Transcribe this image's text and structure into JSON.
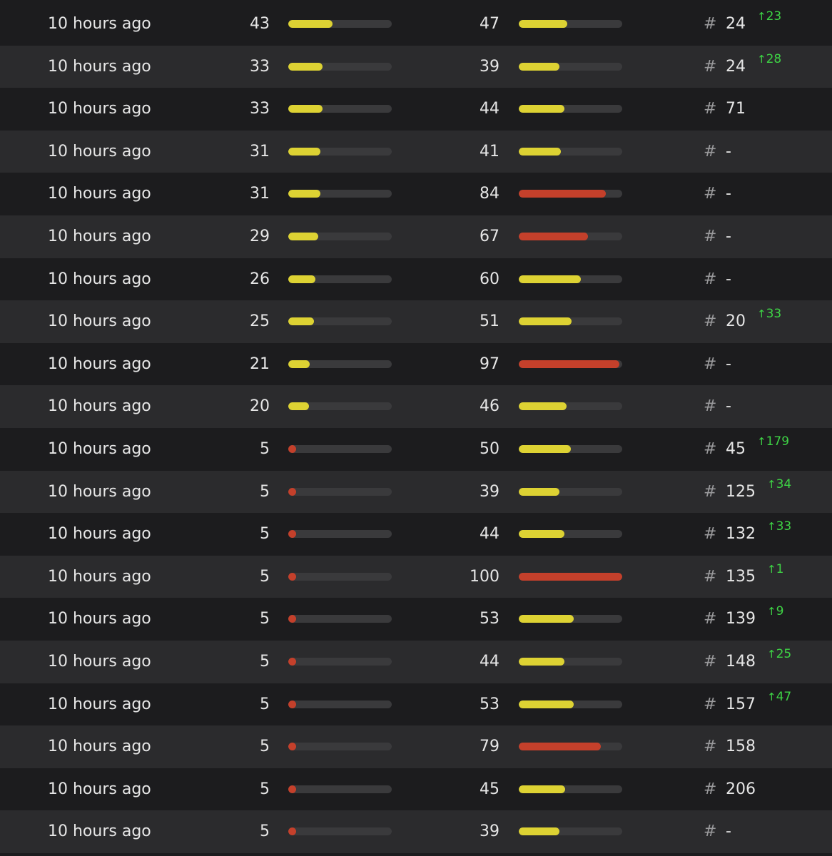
{
  "colors": {
    "yellow": "#ddd233",
    "red": "#c4402b",
    "track": "#3a3a3c",
    "positive": "#3ed345"
  },
  "icons": {
    "change": "arrow-up-icon"
  },
  "rows": [
    {
      "time": "10 hours ago",
      "score1": 43,
      "fill1": 0.43,
      "color1": "yellow",
      "score2": 47,
      "fill2": 0.47,
      "color2": "yellow",
      "hash": "#",
      "rank": "24",
      "change": "23"
    },
    {
      "time": "10 hours ago",
      "score1": 33,
      "fill1": 0.33,
      "color1": "yellow",
      "score2": 39,
      "fill2": 0.39,
      "color2": "yellow",
      "hash": "#",
      "rank": "24",
      "change": "28"
    },
    {
      "time": "10 hours ago",
      "score1": 33,
      "fill1": 0.33,
      "color1": "yellow",
      "score2": 44,
      "fill2": 0.44,
      "color2": "yellow",
      "hash": "#",
      "rank": "71",
      "change": ""
    },
    {
      "time": "10 hours ago",
      "score1": 31,
      "fill1": 0.31,
      "color1": "yellow",
      "score2": 41,
      "fill2": 0.41,
      "color2": "yellow",
      "hash": "#",
      "rank": "-",
      "change": ""
    },
    {
      "time": "10 hours ago",
      "score1": 31,
      "fill1": 0.31,
      "color1": "yellow",
      "score2": 84,
      "fill2": 0.84,
      "color2": "red",
      "hash": "#",
      "rank": "-",
      "change": ""
    },
    {
      "time": "10 hours ago",
      "score1": 29,
      "fill1": 0.29,
      "color1": "yellow",
      "score2": 67,
      "fill2": 0.67,
      "color2": "red",
      "hash": "#",
      "rank": "-",
      "change": ""
    },
    {
      "time": "10 hours ago",
      "score1": 26,
      "fill1": 0.26,
      "color1": "yellow",
      "score2": 60,
      "fill2": 0.6,
      "color2": "yellow",
      "hash": "#",
      "rank": "-",
      "change": ""
    },
    {
      "time": "10 hours ago",
      "score1": 25,
      "fill1": 0.25,
      "color1": "yellow",
      "score2": 51,
      "fill2": 0.51,
      "color2": "yellow",
      "hash": "#",
      "rank": "20",
      "change": "33"
    },
    {
      "time": "10 hours ago",
      "score1": 21,
      "fill1": 0.21,
      "color1": "yellow",
      "score2": 97,
      "fill2": 0.97,
      "color2": "red",
      "hash": "#",
      "rank": "-",
      "change": ""
    },
    {
      "time": "10 hours ago",
      "score1": 20,
      "fill1": 0.2,
      "color1": "yellow",
      "score2": 46,
      "fill2": 0.46,
      "color2": "yellow",
      "hash": "#",
      "rank": "-",
      "change": ""
    },
    {
      "time": "10 hours ago",
      "score1": 5,
      "fill1": 0.05,
      "color1": "red",
      "score2": 50,
      "fill2": 0.5,
      "color2": "yellow",
      "hash": "#",
      "rank": "45",
      "change": "179"
    },
    {
      "time": "10 hours ago",
      "score1": 5,
      "fill1": 0.05,
      "color1": "red",
      "score2": 39,
      "fill2": 0.39,
      "color2": "yellow",
      "hash": "#",
      "rank": "125",
      "change": "34"
    },
    {
      "time": "10 hours ago",
      "score1": 5,
      "fill1": 0.05,
      "color1": "red",
      "score2": 44,
      "fill2": 0.44,
      "color2": "yellow",
      "hash": "#",
      "rank": "132",
      "change": "33"
    },
    {
      "time": "10 hours ago",
      "score1": 5,
      "fill1": 0.05,
      "color1": "red",
      "score2": 100,
      "fill2": 1.0,
      "color2": "red",
      "hash": "#",
      "rank": "135",
      "change": "1"
    },
    {
      "time": "10 hours ago",
      "score1": 5,
      "fill1": 0.05,
      "color1": "red",
      "score2": 53,
      "fill2": 0.53,
      "color2": "yellow",
      "hash": "#",
      "rank": "139",
      "change": "9"
    },
    {
      "time": "10 hours ago",
      "score1": 5,
      "fill1": 0.05,
      "color1": "red",
      "score2": 44,
      "fill2": 0.44,
      "color2": "yellow",
      "hash": "#",
      "rank": "148",
      "change": "25"
    },
    {
      "time": "10 hours ago",
      "score1": 5,
      "fill1": 0.05,
      "color1": "red",
      "score2": 53,
      "fill2": 0.53,
      "color2": "yellow",
      "hash": "#",
      "rank": "157",
      "change": "47"
    },
    {
      "time": "10 hours ago",
      "score1": 5,
      "fill1": 0.05,
      "color1": "red",
      "score2": 79,
      "fill2": 0.79,
      "color2": "red",
      "hash": "#",
      "rank": "158",
      "change": ""
    },
    {
      "time": "10 hours ago",
      "score1": 5,
      "fill1": 0.05,
      "color1": "red",
      "score2": 45,
      "fill2": 0.45,
      "color2": "yellow",
      "hash": "#",
      "rank": "206",
      "change": ""
    },
    {
      "time": "10 hours ago",
      "score1": 5,
      "fill1": 0.05,
      "color1": "red",
      "score2": 39,
      "fill2": 0.39,
      "color2": "yellow",
      "hash": "#",
      "rank": "-",
      "change": ""
    }
  ]
}
